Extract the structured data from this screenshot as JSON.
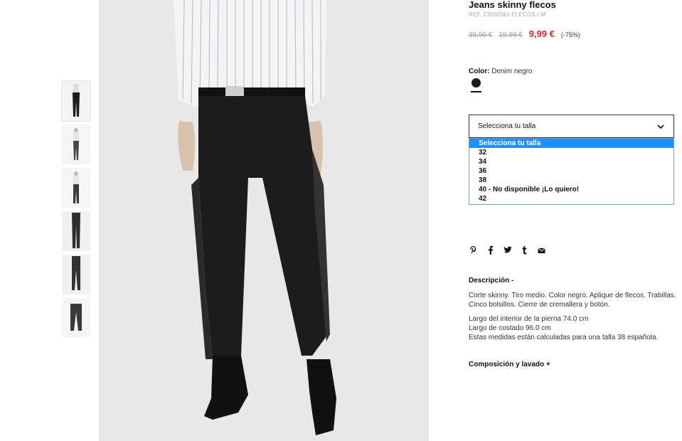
{
  "product": {
    "title": "Jeans skinny flecos",
    "ref": "REF. 23000561-FLECOS-LM",
    "price_original": "39,99 €",
    "price_previous": "19,99 €",
    "price_current": "9,99 €",
    "discount": "(-75%)"
  },
  "color": {
    "label": "Color:",
    "value": "Denim negro",
    "swatch_color": "#1a1a1a"
  },
  "size": {
    "placeholder": "Selecciona tu talla",
    "options": [
      "Selecciona tu talla",
      "32",
      "34",
      "36",
      "38",
      "40 - No disponible ¡Lo quiero!",
      "42"
    ],
    "selected_index": 0
  },
  "social": {
    "icons": [
      "pinterest-icon",
      "facebook-icon",
      "twitter-icon",
      "tumblr-icon",
      "email-icon"
    ],
    "glyphs": [
      "℗",
      "f",
      "t",
      "t",
      "✉"
    ]
  },
  "description": {
    "title": "Descripción -",
    "paragraph1": "Corte skinny. Tiro medio. Color negro. Aplique de flecos. Trabillas. Cinco bolsillos. Cierre de cremallera y botón.",
    "line1": "Largo del interior de la pierna 74.0 cm",
    "line2": "Largo de costado 96.0 cm",
    "line3": "Estas medidas están calculadas para una talla 38 española."
  },
  "composition": {
    "title": "Composición y lavado +"
  },
  "colors": {
    "sale_red": "#e0262b",
    "highlight_blue": "#1e90ff"
  }
}
